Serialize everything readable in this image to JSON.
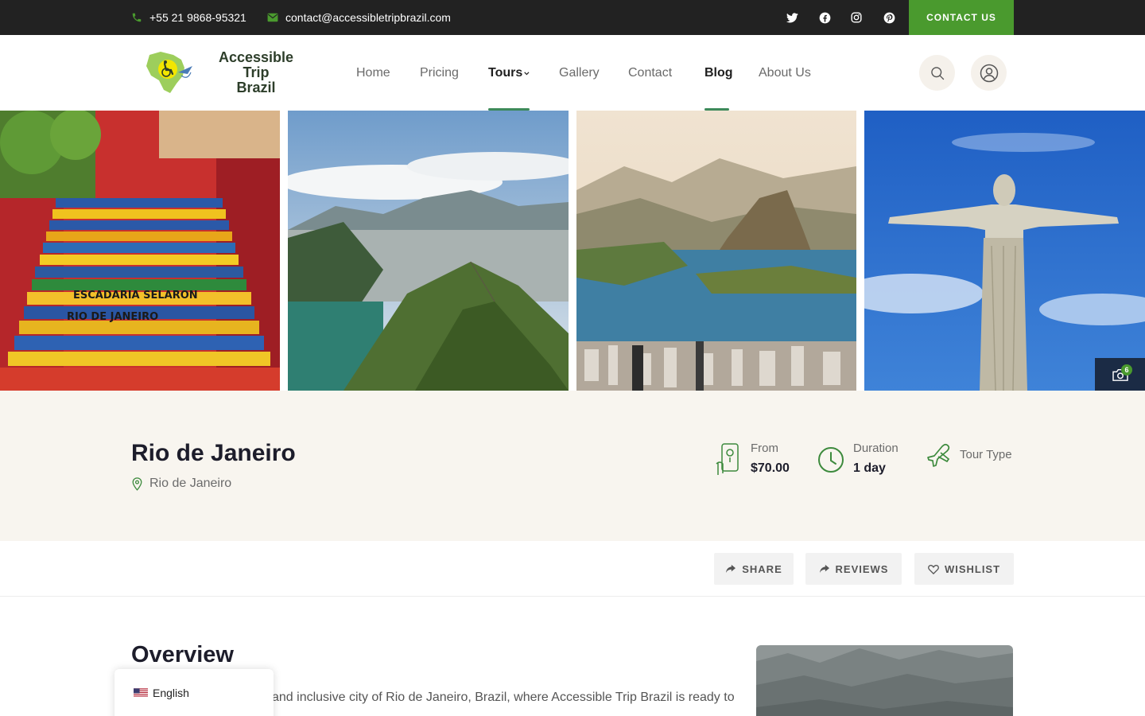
{
  "topbar": {
    "phone": "+55 21 9868-95321",
    "email": "contact@accessibletripbrazil.com",
    "social_icons": [
      "twitter-icon",
      "facebook-icon",
      "instagram-icon",
      "pinterest-icon"
    ],
    "contact_label": "CONTACT US",
    "accent": "#4a9a2e"
  },
  "header": {
    "logo_line1": "Accessible Trip",
    "logo_line2": "Brazil",
    "nav": [
      {
        "label": "Home"
      },
      {
        "label": "Pricing"
      },
      {
        "label": "Tours"
      },
      {
        "label": "Gallery"
      },
      {
        "label": "Contact"
      },
      {
        "label": "Blog"
      },
      {
        "label": "About Us"
      }
    ],
    "active_nav": [
      "Tours",
      "Blog"
    ]
  },
  "gallery": {
    "photo_count": "6"
  },
  "tour": {
    "title": "Rio de Janeiro",
    "location": "Rio de Janeiro",
    "price_label": "From",
    "price_value": "$70.00",
    "duration_label": "Duration",
    "duration_value": "1 day",
    "type_label": "Tour Type"
  },
  "actions": {
    "share": "SHARE",
    "reviews": "REVIEWS",
    "wishlist": "WISHLIST"
  },
  "overview": {
    "title": "Overview",
    "text": "and inclusive city of Rio de Janeiro, Brazil, where Accessible Trip Brazil is ready to"
  },
  "language": {
    "current": "English"
  }
}
